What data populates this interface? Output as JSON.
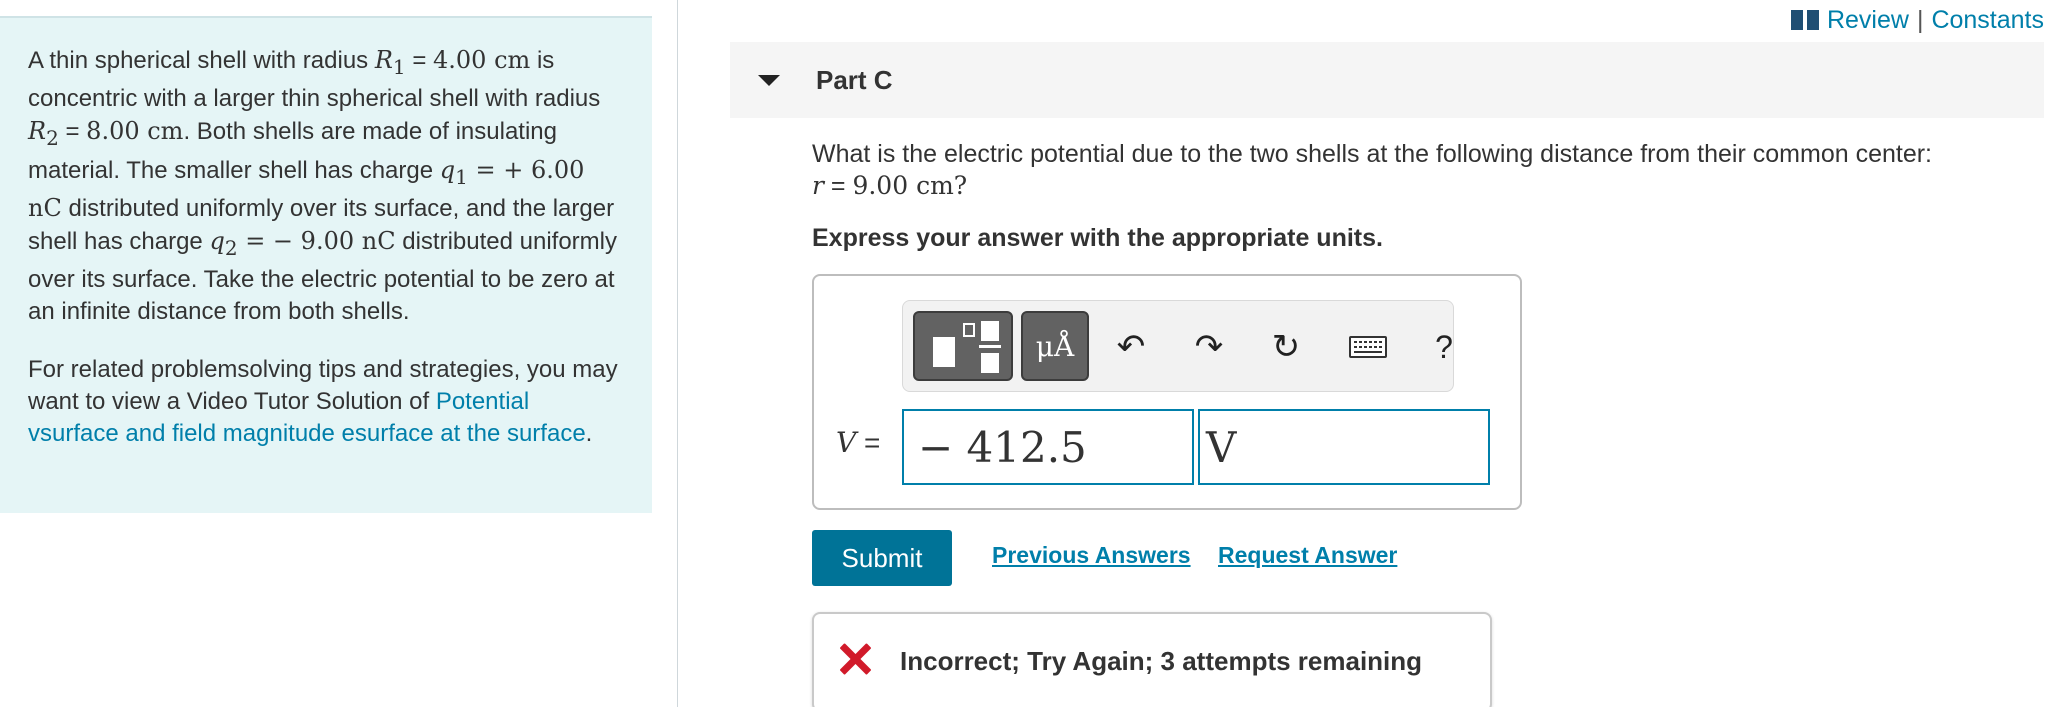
{
  "problem": {
    "p1": {
      "t1": "A thin spherical shell with radius ",
      "r1_sym": "R",
      "r1_sub": "1",
      "t2": " = ",
      "r1_val": "4.00 cm",
      "t3": " is concentric with a larger thin spherical shell with radius ",
      "r2_sym": "R",
      "r2_sub": "2",
      "t4": " = ",
      "r2_val": "8.00 cm",
      "t5": ". Both shells are made of insulating material. The smaller shell has charge ",
      "q1_sym": "q",
      "q1_sub": "1",
      "q1_val": " = + 6.00 nC",
      "t6": " distributed uniformly over its surface, and the larger shell has charge ",
      "q2_sym": "q",
      "q2_sub": "2",
      "q2_val": " = − 9.00 nC",
      "t7": " distributed uniformly over its surface. Take the electric potential to be zero at an infinite distance from both shells."
    },
    "p2": {
      "t1": "For related problemsolving tips and strategies, you may want to view a Video Tutor Solution of ",
      "link": "Potential vsurface and field magnitude esurface at the surface",
      "t2": "."
    }
  },
  "toplinks": {
    "review": "Review",
    "separator": "|",
    "constants": "Constants"
  },
  "part": {
    "title": "Part C"
  },
  "question": {
    "line1": "What is the electric potential due to the two shells at the following distance from their common center:",
    "r_sym": "r",
    "r_eq": " = ",
    "r_val": "9.00 cm",
    "r_end": "?"
  },
  "instruction": "Express your answer with the appropriate units.",
  "toolbar": {
    "units_label": "μÅ",
    "help_label": "?"
  },
  "answer": {
    "var": "V",
    "eq": " =",
    "value": "− 412.5",
    "units": "V"
  },
  "buttons": {
    "submit": "Submit",
    "previous": "Previous Answers",
    "request": "Request Answer"
  },
  "feedback": {
    "text": "Incorrect; Try Again; 3 attempts remaining"
  },
  "colors": {
    "accent": "#007faa",
    "submit_bg": "#007397",
    "panel_bg": "#e5f5f6",
    "error": "#d11a2a"
  }
}
